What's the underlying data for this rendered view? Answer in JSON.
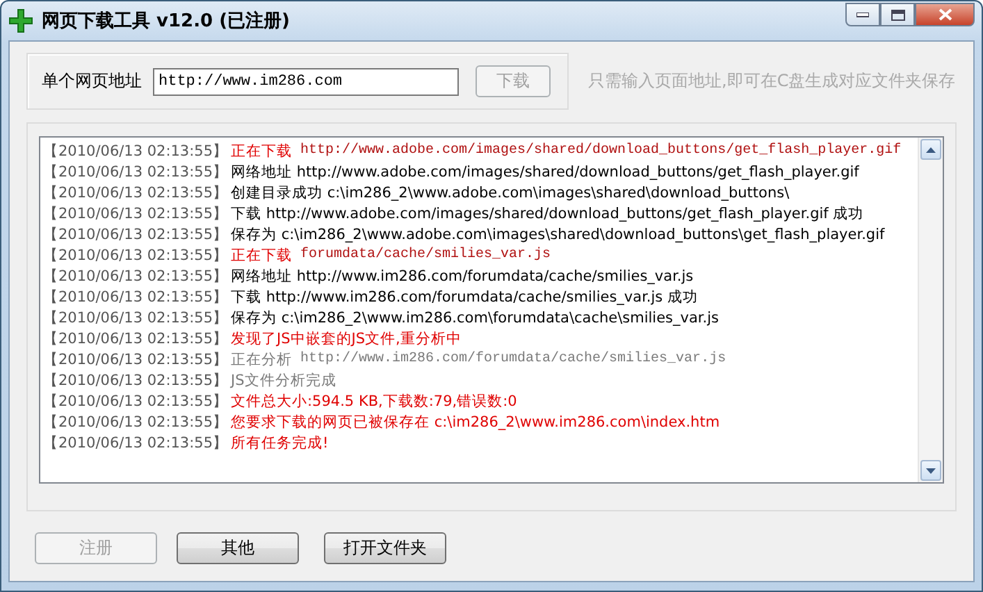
{
  "window": {
    "title": "网页下载工具 v12.0 (已注册)"
  },
  "url_bar": {
    "label": "单个网页地址",
    "value": "http://www.im286.com",
    "download_button": {
      "label": "下载",
      "disabled": true
    },
    "hint": "只需输入页面地址,即可在C盘生成对应文件夹保存"
  },
  "log": [
    {
      "time": "【2010/06/13 02:13:55】",
      "kind": "download",
      "text": "正在下载",
      "detail": "http://www.adobe.com/images/shared/download_buttons/get_flash_player.gif"
    },
    {
      "time": "【2010/06/13 02:13:55】",
      "kind": "info",
      "text": "网络地址 http://www.adobe.com/images/shared/download_buttons/get_flash_player.gif"
    },
    {
      "time": "【2010/06/13 02:13:55】",
      "kind": "info",
      "text": "创建目录成功 c:\\im286_2\\www.adobe.com\\images\\shared\\download_buttons\\"
    },
    {
      "time": "【2010/06/13 02:13:55】",
      "kind": "info",
      "text": "下载 http://www.adobe.com/images/shared/download_buttons/get_flash_player.gif 成功"
    },
    {
      "time": "【2010/06/13 02:13:55】",
      "kind": "info",
      "text": "保存为 c:\\im286_2\\www.adobe.com\\images\\shared\\download_buttons\\get_flash_player.gif"
    },
    {
      "time": "【2010/06/13 02:13:55】",
      "kind": "download",
      "text": "正在下载",
      "detail": "forumdata/cache/smilies_var.js"
    },
    {
      "time": "【2010/06/13 02:13:55】",
      "kind": "info",
      "text": "网络地址 http://www.im286.com/forumdata/cache/smilies_var.js"
    },
    {
      "time": "【2010/06/13 02:13:55】",
      "kind": "info",
      "text": "下载 http://www.im286.com/forumdata/cache/smilies_var.js 成功"
    },
    {
      "time": "【2010/06/13 02:13:55】",
      "kind": "info",
      "text": "保存为 c:\\im286_2\\www.im286.com\\forumdata\\cache\\smilies_var.js"
    },
    {
      "time": "【2010/06/13 02:13:55】",
      "kind": "alert",
      "text": "发现了JS中嵌套的JS文件,重分析中"
    },
    {
      "time": "【2010/06/13 02:13:55】",
      "kind": "analysis",
      "text": "正在分析",
      "detail": "http://www.im286.com/forumdata/cache/smilies_var.js"
    },
    {
      "time": "【2010/06/13 02:13:55】",
      "kind": "analysis",
      "text": "JS文件分析完成"
    },
    {
      "time": "【2010/06/13 02:13:55】",
      "kind": "alert",
      "text": "文件总大小:594.5 KB,下载数:79,错误数:0"
    },
    {
      "time": "【2010/06/13 02:13:55】",
      "kind": "alert",
      "text": "您要求下载的网页已被保存在 c:\\im286_2\\www.im286.com\\index.htm"
    },
    {
      "time": "【2010/06/13 02:13:55】",
      "kind": "alert",
      "text": "所有任务完成!"
    }
  ],
  "buttons": [
    {
      "label": "注册",
      "disabled": true
    },
    {
      "label": "其他",
      "disabled": false
    },
    {
      "label": "打开文件夹",
      "disabled": false
    }
  ]
}
